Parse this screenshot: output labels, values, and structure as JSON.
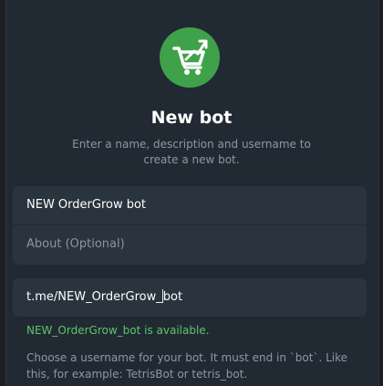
{
  "header": {
    "logo_icon": "shopping-cart-growth-icon",
    "title": "New bot",
    "subtitle": "Enter a name, description and username to create a new bot."
  },
  "form": {
    "name_value": "NEW OrderGrow bot",
    "about_placeholder": "About (Optional)",
    "username_before_caret": "t.me/NEW_OrderGrow_",
    "username_after_caret": "bot"
  },
  "status": {
    "availability": "NEW_OrderGrow_bot is available."
  },
  "hint": {
    "text": "Choose a username for your bot. It must end in `bot`. Like this, for example: TetrisBot or tetris_bot."
  },
  "colors": {
    "background": "#212a33",
    "field": "#2a343f",
    "logo": "#3fa24a",
    "success": "#5ec46a",
    "muted": "#8c98a4"
  }
}
